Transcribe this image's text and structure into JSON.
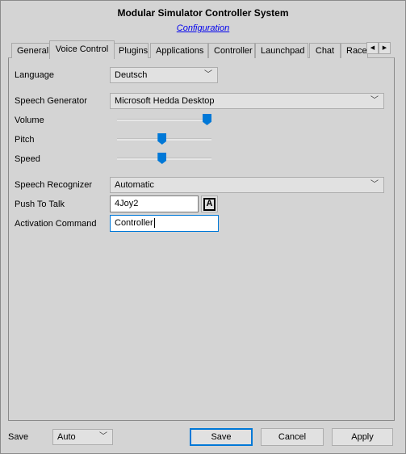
{
  "window": {
    "title": "Modular Simulator Controller System",
    "subtitle_link": "Configuration"
  },
  "tabs": [
    {
      "label": "General"
    },
    {
      "label": "Voice Control",
      "active": true
    },
    {
      "label": "Plugins"
    },
    {
      "label": "Applications"
    },
    {
      "label": "Controller"
    },
    {
      "label": "Launchpad"
    },
    {
      "label": "Chat"
    },
    {
      "label": "Race"
    }
  ],
  "tab_scroll": {
    "left_icon": "arrow-left-icon",
    "right_icon": "arrow-right-icon"
  },
  "voice": {
    "language": {
      "label": "Language",
      "value": "Deutsch"
    },
    "generator": {
      "label": "Speech Generator",
      "value": "Microsoft Hedda Desktop"
    },
    "volume": {
      "label": "Volume",
      "value": 100
    },
    "pitch": {
      "label": "Pitch",
      "value": 50
    },
    "speed": {
      "label": "Speed",
      "value": 50
    },
    "recognizer": {
      "label": "Speech Recognizer",
      "value": "Automatic"
    },
    "push_to_talk": {
      "label": "Push To Talk",
      "value": "4Joy2",
      "button": "A"
    },
    "activation": {
      "label": "Activation Command",
      "value": "Controller"
    }
  },
  "footer": {
    "save_label": "Save",
    "save_mode": "Auto",
    "save_button": "Save",
    "cancel_button": "Cancel",
    "apply_button": "Apply"
  },
  "colors": {
    "accent": "#0078d7",
    "link": "#0000ee"
  }
}
